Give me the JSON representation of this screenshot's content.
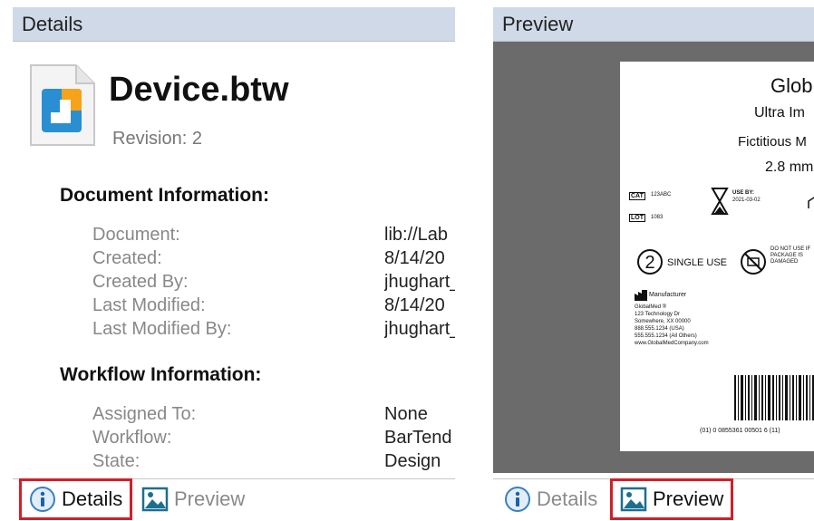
{
  "details_pane": {
    "header": "Details",
    "document_name": "Device.btw",
    "revision": "Revision: 2",
    "document_information": {
      "title": "Document Information:",
      "rows": [
        {
          "label": "Document:",
          "value": "lib://Lab"
        },
        {
          "label": "Created:",
          "value": "8/14/20"
        },
        {
          "label": "Created By:",
          "value": "jhughart_"
        },
        {
          "label": "Last Modified:",
          "value": "8/14/20"
        },
        {
          "label": "Last Modified By:",
          "value": "jhughart_"
        }
      ]
    },
    "workflow_information": {
      "title": "Workflow Information:",
      "rows": [
        {
          "label": "Assigned To:",
          "value": "None"
        },
        {
          "label": "Workflow:",
          "value": "BarTend"
        },
        {
          "label": "State:",
          "value": "Design"
        }
      ]
    },
    "tabs": {
      "details": "Details",
      "preview": "Preview"
    }
  },
  "preview_pane": {
    "header": "Preview",
    "label": {
      "line1": "Glob",
      "line2": "Ultra Im",
      "line3": "Fictitious M",
      "line4": "2.8 mm",
      "cat": "CAT",
      "cat_value": "123ABC",
      "lot": "LOT",
      "lot_value": "1083",
      "use_by": "USE BY:",
      "use_by_value": "2021-03-02",
      "single_use": "SINGLE USE",
      "do_not_use": "DO NOT USE IF PACKAGE IS DAMAGED",
      "manufacturer": "Manufacturer",
      "address": [
        "GlobalMed ®",
        "123 Technology Dr",
        "Somewhere, XX 00000",
        "888.555.1234 (USA)",
        "555.555.1234 (All Others)",
        "www.GlobalMedCompany.com"
      ],
      "barcode_text": "(01) 0 0855361 00501 6 (11)"
    },
    "tabs": {
      "details": "Details",
      "preview": "Preview"
    }
  },
  "colors": {
    "header_bg": "#cfd9e8",
    "highlight": "#d21f27",
    "preview_bg": "#6b6b6b"
  }
}
